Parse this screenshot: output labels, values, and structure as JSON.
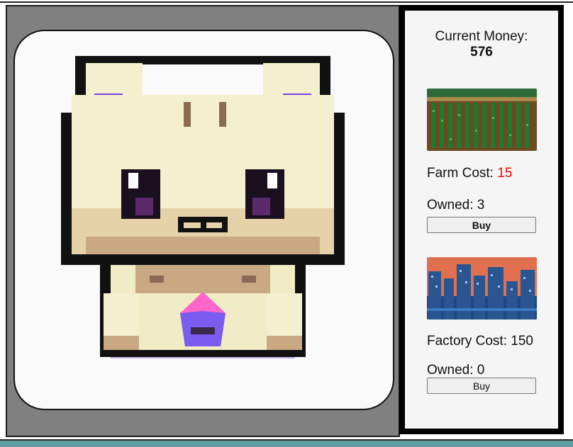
{
  "colors": {
    "page_background": "#ffffff",
    "game_panel_background": "#808080",
    "card_background": "#fafafb",
    "shop_background": "#f5f5f5",
    "shop_border": "#000000",
    "affordable_cost": "#111111",
    "unaffordable_cost": "#ff0000",
    "bottom_bar": "#5f9ea0"
  },
  "clicker": {
    "image_name": "pixel-cat-icon"
  },
  "shop": {
    "money_label": "Current Money:",
    "money_value": "576",
    "items": [
      {
        "image_name": "farm-field-image",
        "cost_label": "Farm Cost:",
        "cost_value": "15",
        "cost_color": "#ff0000",
        "owned_text": "Owned: 3",
        "buy_label": "Buy"
      },
      {
        "image_name": "factory-city-image",
        "cost_label": "Factory Cost:",
        "cost_value": "150",
        "cost_color": "#111111",
        "owned_text": "Owned: 0",
        "buy_label": "Buy"
      }
    ]
  }
}
